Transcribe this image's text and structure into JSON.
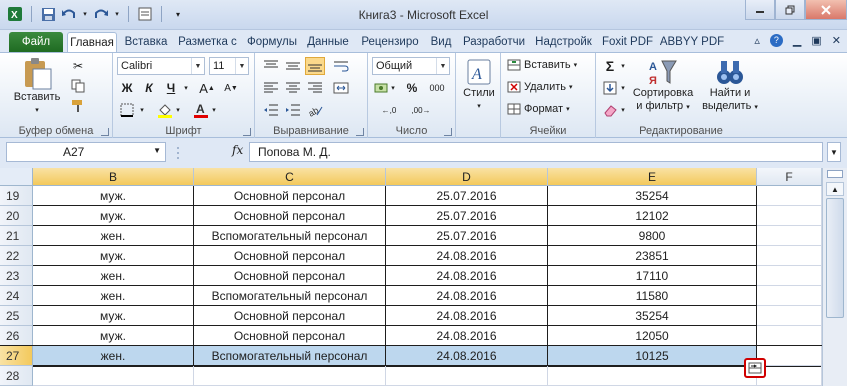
{
  "window": {
    "title": "Книга3  -  Microsoft Excel",
    "minimize_icon": "minimize-icon",
    "maximize_icon": "restore-icon",
    "close_icon": "close-icon"
  },
  "quick_access": [
    "excel-logo-icon",
    "save-icon",
    "undo-icon",
    "redo-icon",
    "customize-qat-icon"
  ],
  "tabs": [
    {
      "label": "Файл"
    },
    {
      "label": "Главная"
    },
    {
      "label": "Вставка"
    },
    {
      "label": "Разметка с"
    },
    {
      "label": "Формулы"
    },
    {
      "label": "Данные"
    },
    {
      "label": "Рецензиро"
    },
    {
      "label": "Вид"
    },
    {
      "label": "Разработчи"
    },
    {
      "label": "Надстройк"
    },
    {
      "label": "Foxit PDF"
    },
    {
      "label": "ABBYY PDF"
    }
  ],
  "ribbon": {
    "clipboard": {
      "label": "Буфер обмена",
      "paste": "Вставить"
    },
    "font": {
      "label": "Шрифт",
      "font_name": "Calibri",
      "font_size": "11",
      "bold": "Ж",
      "italic": "К",
      "underline": "Ч"
    },
    "alignment": {
      "label": "Выравнивание"
    },
    "number": {
      "label": "Число",
      "format": "Общий",
      "percent": "%",
      "thousands": "000"
    },
    "styles": {
      "label": "Стили"
    },
    "cells": {
      "label": "Ячейки",
      "insert": "Вставить",
      "delete": "Удалить",
      "format": "Формат"
    },
    "editing": {
      "label": "Редактирование",
      "sort": "Сортировка",
      "sort2": "и фильтр",
      "find": "Найти и",
      "find2": "выделить",
      "sum_icon": "Σ"
    }
  },
  "formula_bar": {
    "name_box": "A27",
    "fx": "fx",
    "value": "Попова М. Д."
  },
  "columns": [
    "B",
    "C",
    "D",
    "E",
    "F"
  ],
  "rows": [
    {
      "num": "19",
      "b": "муж.",
      "c": "Основной персонал",
      "d": "25.07.2016",
      "e": "35254"
    },
    {
      "num": "20",
      "b": "муж.",
      "c": "Основной персонал",
      "d": "25.07.2016",
      "e": "12102"
    },
    {
      "num": "21",
      "b": "жен.",
      "c": "Вспомогательный персонал",
      "d": "25.07.2016",
      "e": "9800"
    },
    {
      "num": "22",
      "b": "муж.",
      "c": "Основной персонал",
      "d": "24.08.2016",
      "e": "23851"
    },
    {
      "num": "23",
      "b": "жен.",
      "c": "Основной персонал",
      "d": "24.08.2016",
      "e": "17110"
    },
    {
      "num": "24",
      "b": "жен.",
      "c": "Вспомогательный персонал",
      "d": "24.08.2016",
      "e": "11580"
    },
    {
      "num": "25",
      "b": "муж.",
      "c": "Основной персонал",
      "d": "24.08.2016",
      "e": "35254"
    },
    {
      "num": "26",
      "b": "муж.",
      "c": "Основной персонал",
      "d": "24.08.2016",
      "e": "12050"
    },
    {
      "num": "27",
      "b": "жен.",
      "c": "Вспомогательный персонал",
      "d": "24.08.2016",
      "e": "10125"
    },
    {
      "num": "28",
      "b": "",
      "c": "",
      "d": "",
      "e": ""
    }
  ],
  "selected_row": "27",
  "quick_analysis_icon": "quick-analysis-icon"
}
